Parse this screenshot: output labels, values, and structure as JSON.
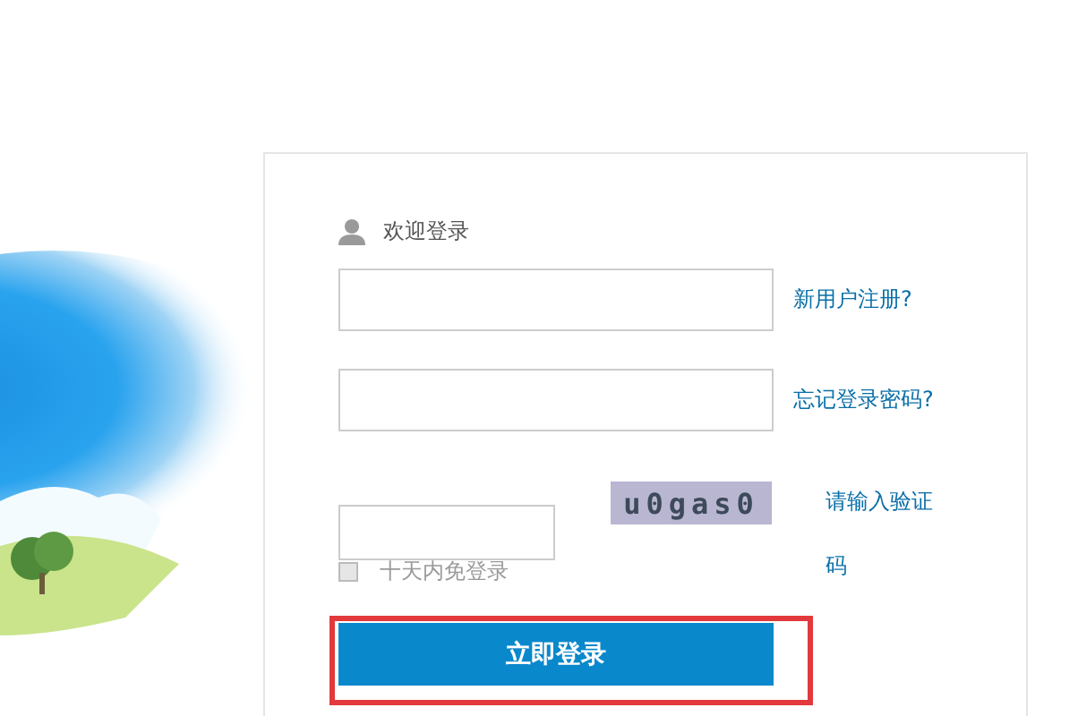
{
  "greeting": "欢迎登录",
  "links": [
    {
      "text": "新用户注册?"
    },
    {
      "text": "忘记登录密码?"
    }
  ],
  "captcha": {
    "code": "u0gas0",
    "hint": "请输入验证码"
  },
  "remember": {
    "label": "十天内免登录",
    "checked": false
  },
  "login_button": {
    "label": "立即登录",
    "highlighted": true
  }
}
